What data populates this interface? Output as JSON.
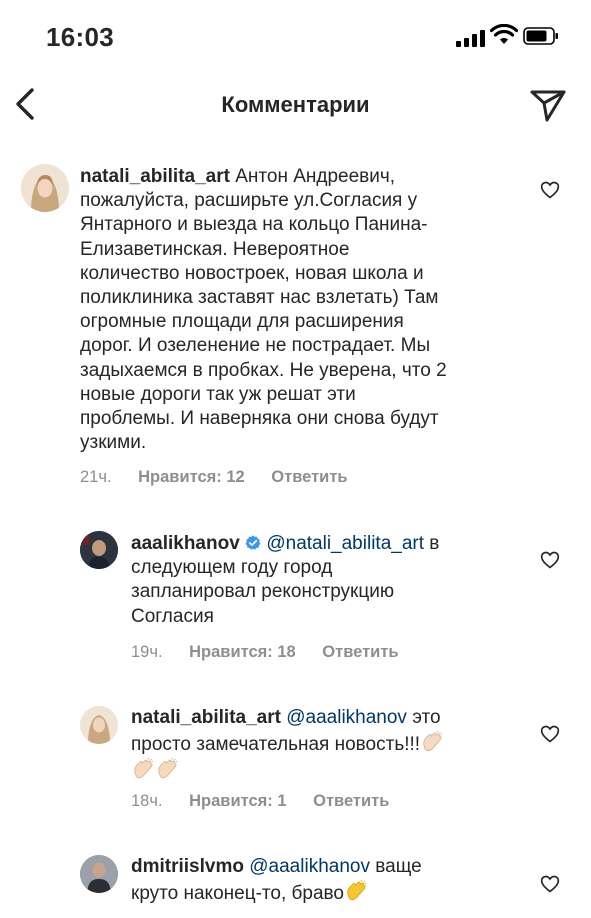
{
  "status_bar": {
    "time": "16:03"
  },
  "header": {
    "title": "Комментарии"
  },
  "comments": [
    {
      "username": "natali_abilita_art",
      "text_lines": [
        "Антон Андреевич,",
        "пожалуйста, расширьте ул.Согласия у",
        "Янтарного и выезда на кольцо Панина-",
        "Елизаветинская. Невероятное",
        "количество новостроек, новая школа и",
        "поликлиника заставят нас взлетать) Там",
        "огромные площади для расширения",
        "дорог. И озеленение не пострадает. Мы",
        "задыхаемся в пробках. Не уверена, что 2",
        "новые дороги так уж решат эти",
        "проблемы. И наверняка они снова будут",
        "узкими."
      ],
      "time": "21ч.",
      "likes": "Нравится: 12",
      "reply": "Ответить"
    },
    {
      "username": "aaalikhanov",
      "mention": "@natali_abilita_art",
      "text_lines": [
        "в",
        "следующем году город",
        "запланировал реконструкцию",
        "Согласия"
      ],
      "time": "19ч.",
      "likes": "Нравится: 18",
      "reply": "Ответить"
    },
    {
      "username": "natali_abilita_art",
      "mention": "@aaalikhanov",
      "text_lines": [
        "это",
        "просто замечательная новость!!!"
      ],
      "emoji": "clapping-hands",
      "time": "18ч.",
      "likes": "Нравится: 1",
      "reply": "Ответить"
    },
    {
      "username": "dmitriislvmo",
      "mention": "@aaalikhanov",
      "text_lines": [
        "ваще",
        "круто наконец-то, браво"
      ],
      "emoji": "clapping-hands"
    }
  ],
  "icons": [
    "back-chevron-icon",
    "send-icon",
    "heart-icon",
    "verified-badge-icon",
    "clapping-hands-emoji"
  ],
  "colors": {
    "text": "#262626",
    "secondary": "#8e8e8e",
    "mention": "#00376b",
    "verified": "#3897f0"
  }
}
